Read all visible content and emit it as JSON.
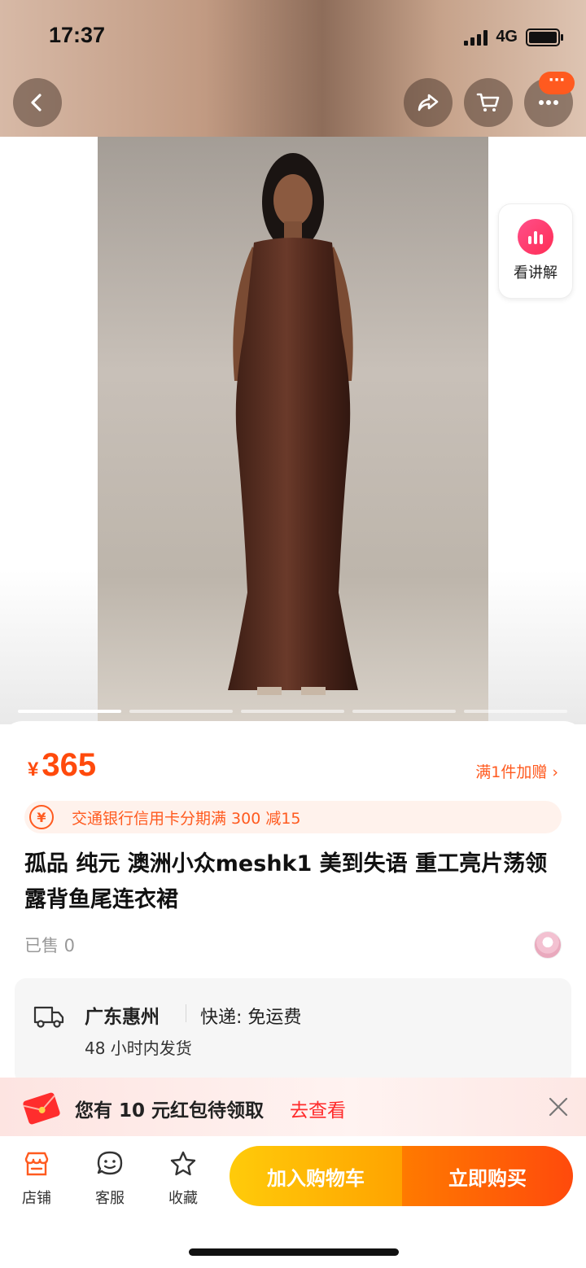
{
  "status_bar": {
    "time": "17:37",
    "network": "4G"
  },
  "header": {
    "back_icon": "chevron-left-icon",
    "share_icon": "share-icon",
    "cart_icon": "cart-icon",
    "more_icon": "more-dots-icon",
    "more_badge": "···"
  },
  "gallery": {
    "explain_label": "看讲解",
    "slide_count": 5,
    "active_slide": 1
  },
  "product": {
    "currency": "¥",
    "price": "365",
    "gift_label": "满1件加赠 ›",
    "promo_text": "交通银行信用卡分期满 300 减15",
    "title": "孤品 纯元 澳洲小众meshk1 美到失语 重工亮片荡领露背鱼尾连衣裙",
    "sold": "已售 0"
  },
  "shipping": {
    "origin": "广东惠州",
    "method": "快递: 免运费",
    "dispatch": "48 小时内发货"
  },
  "red_packet": {
    "text": "您有 10 元红包待领取",
    "link": "去查看"
  },
  "bottom_nav": {
    "store": "店铺",
    "service": "客服",
    "favorite": "收藏",
    "add_to_cart": "加入购物车",
    "buy_now": "立即购买"
  },
  "colors": {
    "accent": "#ff4a0c",
    "cart_button": "#ffb000",
    "buy_button": "#ff5a0a"
  }
}
